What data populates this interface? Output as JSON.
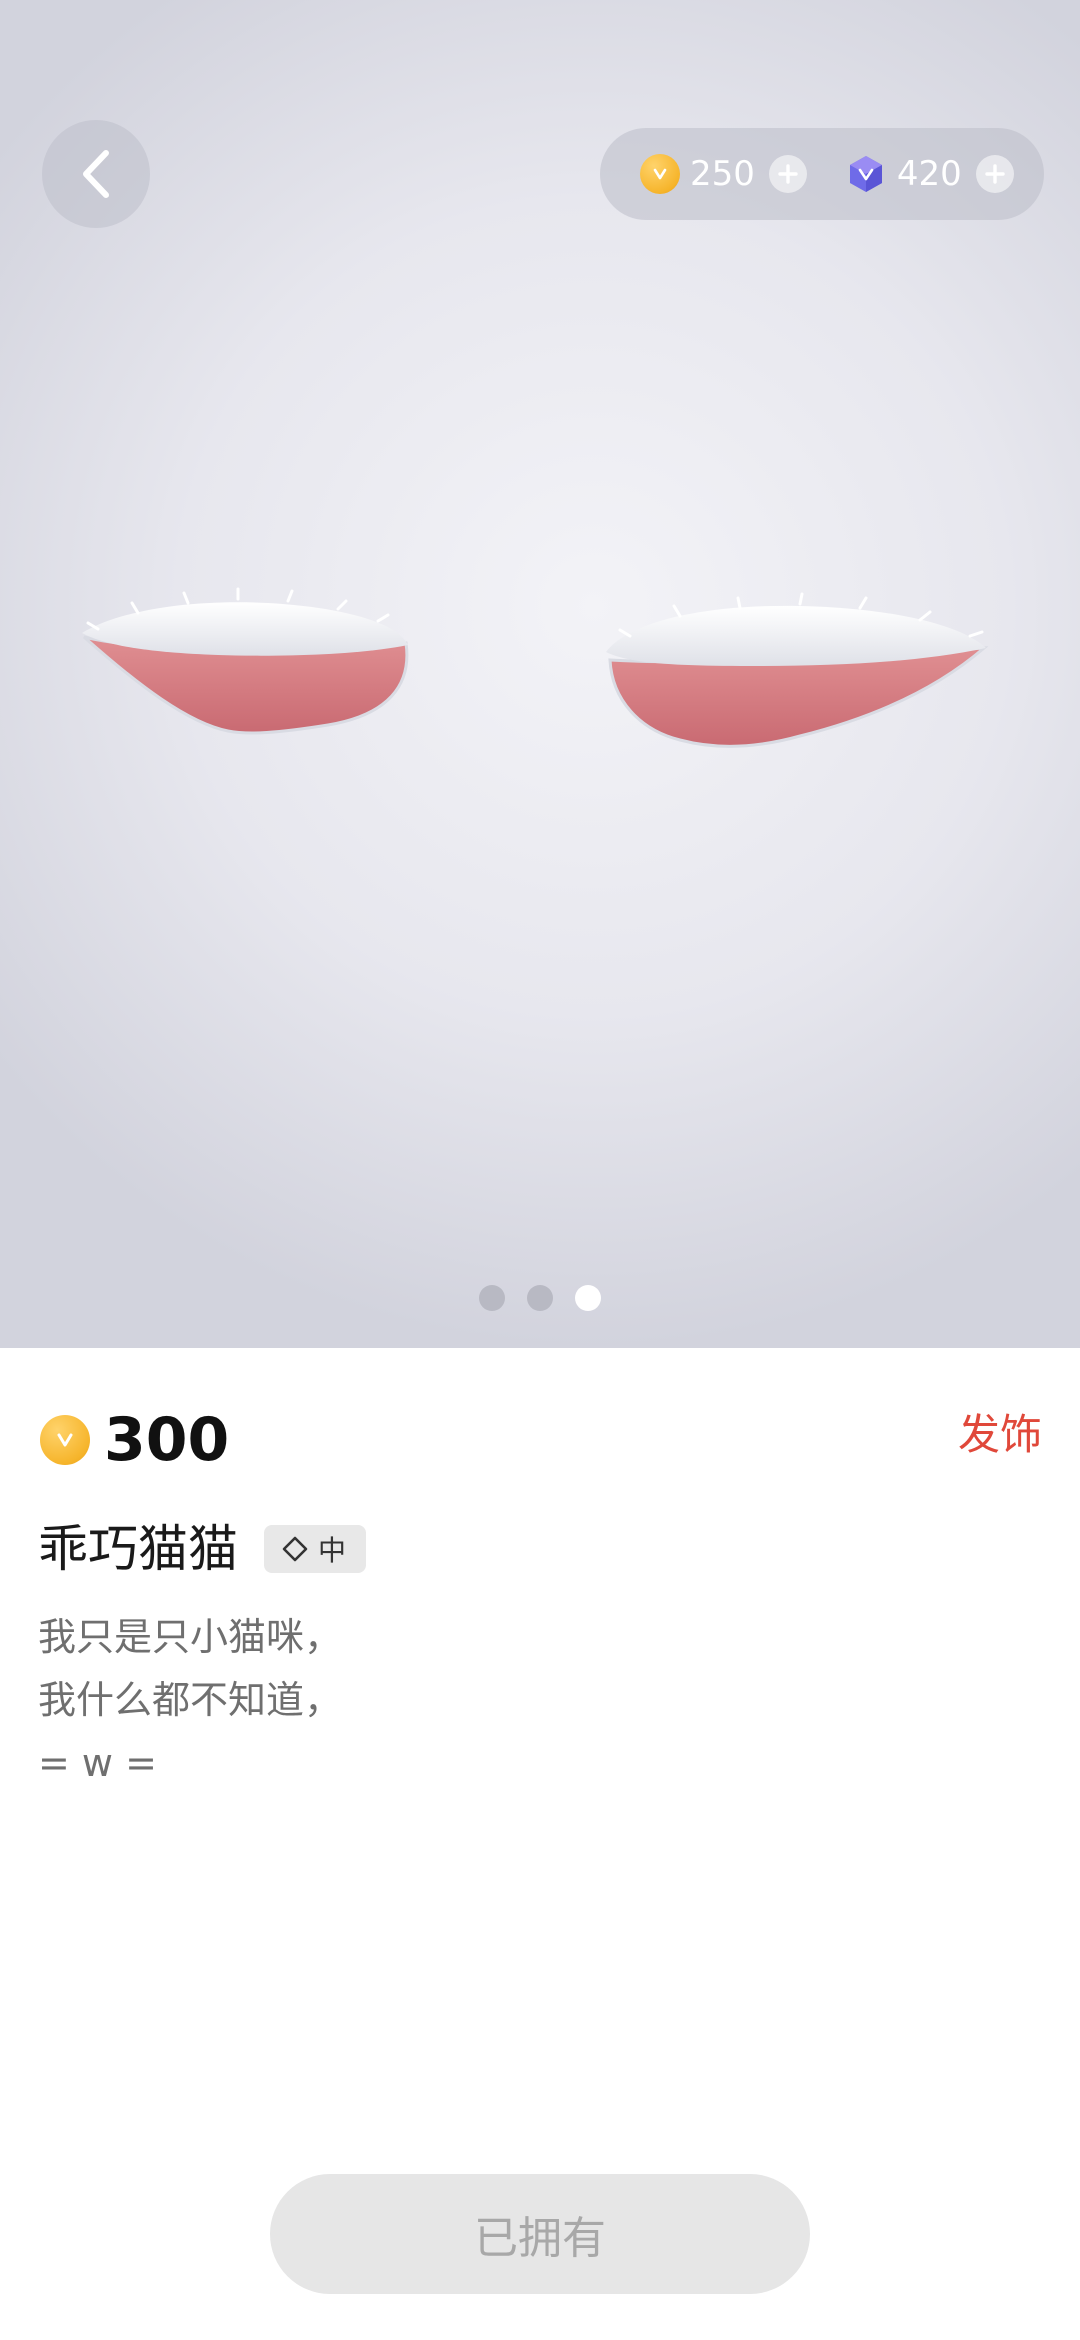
{
  "header": {
    "back_icon": "chevron-left-icon",
    "gold": {
      "icon": "gold-coin-icon",
      "value": "250",
      "add_icon": "plus-icon"
    },
    "gem": {
      "icon": "blue-gem-icon",
      "value": "420",
      "add_icon": "plus-icon"
    }
  },
  "preview": {
    "model": "fluffy-cat-ears",
    "pages": 3,
    "current_page": 3
  },
  "item": {
    "price": "300",
    "currency_icon": "gold-coin-icon",
    "category": "发饰",
    "name": "乖巧猫猫",
    "rarity": "中",
    "rarity_icon": "diamond-outline-icon",
    "description_lines": [
      "我只是只小猫咪，",
      "我什么都不知道，",
      "= w ="
    ]
  },
  "action": {
    "owned_label": "已拥有"
  },
  "colors": {
    "accent_red": "#e0483a",
    "gold": "#f6b52c",
    "gem": "#6f6be8"
  }
}
